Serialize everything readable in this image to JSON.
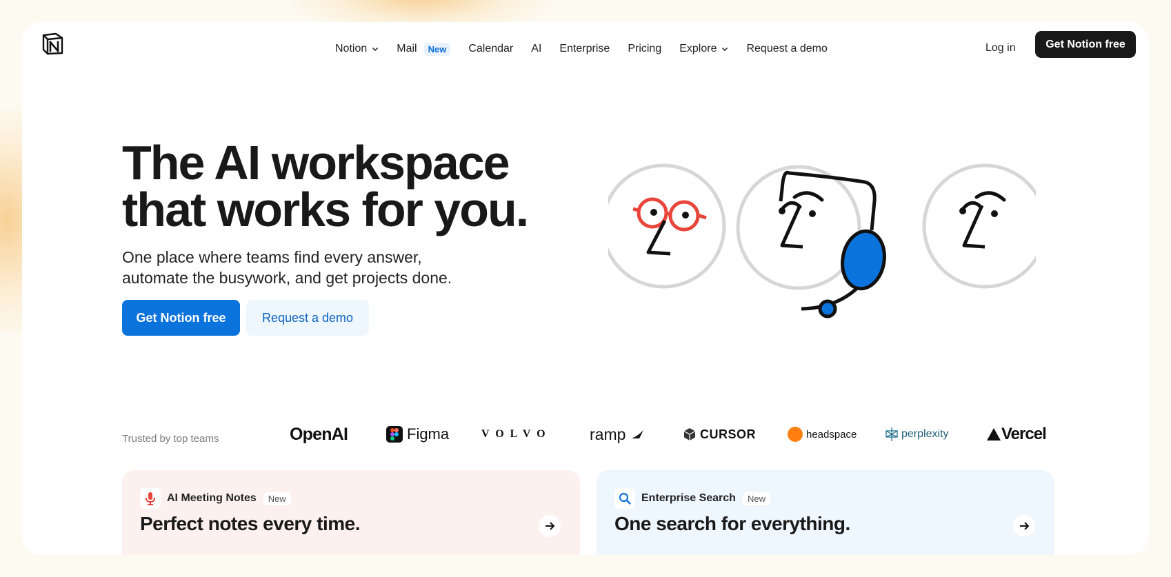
{
  "nav": {
    "items": [
      {
        "label": "Notion",
        "has_chevron": true
      },
      {
        "label": "Mail",
        "badge": "New"
      },
      {
        "label": "Calendar"
      },
      {
        "label": "AI"
      },
      {
        "label": "Enterprise"
      },
      {
        "label": "Pricing"
      },
      {
        "label": "Explore",
        "has_chevron": true
      },
      {
        "label": "Request a demo"
      }
    ],
    "login": "Log in",
    "cta": "Get Notion free"
  },
  "hero": {
    "title_line1": "The AI workspace",
    "title_line2": "that works for you.",
    "subtitle_line1": "One place where teams find every answer,",
    "subtitle_line2": "automate the busywork, and get projects done.",
    "primary_button": "Get Notion free",
    "secondary_button": "Request a demo"
  },
  "trusted": {
    "label": "Trusted by top teams",
    "logos": [
      "OpenAI",
      "Figma",
      "VOLVO",
      "ramp",
      "CURSOR",
      "headspace",
      "perplexity",
      "Vercel"
    ]
  },
  "cards": [
    {
      "icon": "microphone-icon",
      "label": "AI Meeting Notes",
      "badge": "New",
      "title": "Perfect notes every time."
    },
    {
      "icon": "search-icon",
      "label": "Enterprise Search",
      "badge": "New",
      "title": "One search for everything."
    }
  ],
  "colors": {
    "primary_blue": "#0b73dc",
    "dark_button": "#191919",
    "accent_red": "#e8463a",
    "page_background": "#fdfaf2"
  }
}
